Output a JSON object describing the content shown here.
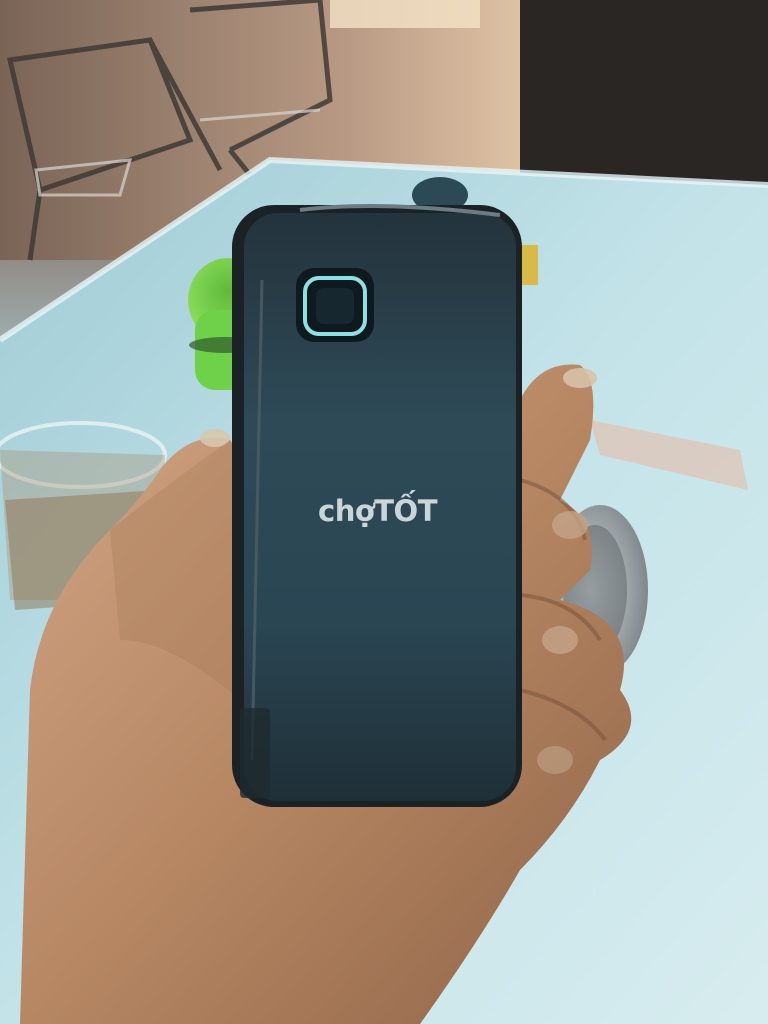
{
  "photo": {
    "subject": "phone-back-held-in-hand",
    "watermark": {
      "part1": "chợ",
      "part2": "TỐT"
    },
    "colors": {
      "phone_body": "#2c4450",
      "phone_edge": "#1c2326",
      "camera_ring": "#8fe0e6",
      "table": "#bfe1e7",
      "ashtray": "#7bd64a",
      "skin": "#b98a66",
      "background_floor": "#8a6f60"
    }
  }
}
